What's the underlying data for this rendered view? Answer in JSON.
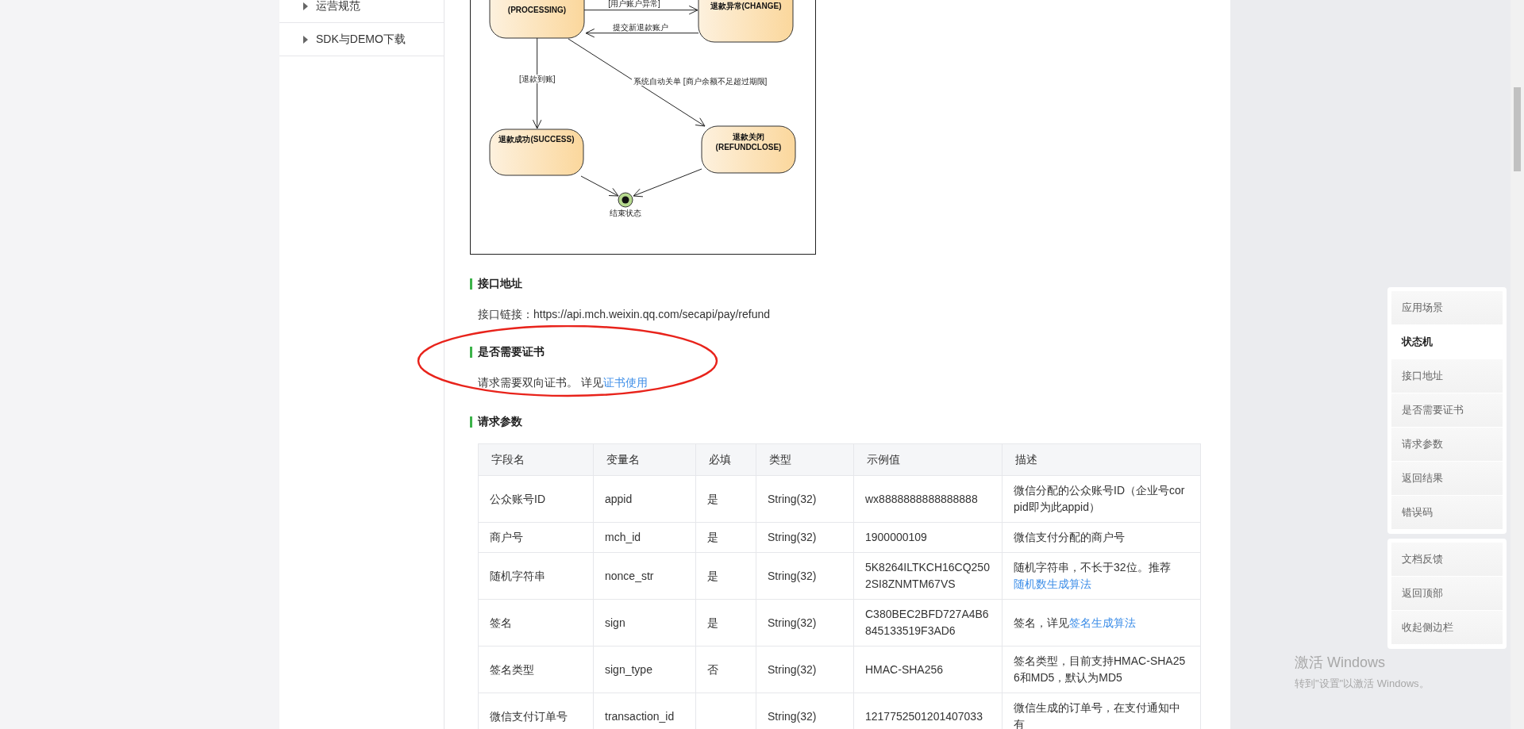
{
  "left_nav": {
    "items": [
      {
        "label": "运营规范"
      },
      {
        "label": "SDK与DEMO下载"
      }
    ]
  },
  "diagram": {
    "states": [
      {
        "lines": [
          "(PROCESSING)"
        ]
      },
      {
        "lines": [
          "退款异常(CHANGE)"
        ]
      },
      {
        "lines": [
          "退款成功(SUCCESS)"
        ]
      },
      {
        "lines": [
          "退款关闭",
          "(REFUNDCLOSE)"
        ]
      }
    ],
    "transitions": [
      {
        "label": "[用户账户异常]"
      },
      {
        "label": "提交新退款账户"
      },
      {
        "label": "[退款到账]"
      },
      {
        "label": "系统自动关单 [商户余额不足超过期限]"
      }
    ],
    "end_label": "结束状态"
  },
  "sections": [
    {
      "title": "接口地址",
      "text": "接口链接：https://api.mch.weixin.qq.com/secapi/pay/refund"
    },
    {
      "title": "是否需要证书",
      "text": "请求需要双向证书。 详见",
      "link": "证书使用"
    },
    {
      "title": "请求参数"
    }
  ],
  "table": {
    "columns": [
      "字段名",
      "变量名",
      "必填",
      "类型",
      "示例值",
      "描述"
    ],
    "rows": [
      {
        "cells": [
          "公众账号ID",
          "appid",
          "是",
          "String(32)",
          "wx8888888888888888"
        ],
        "description": {
          "text": "微信分配的公众账号ID（企业号corpid即为此appid）"
        }
      },
      {
        "cells": [
          "商户号",
          "mch_id",
          "是",
          "String(32)",
          "1900000109"
        ],
        "description": {
          "text": "微信支付分配的商户号"
        }
      },
      {
        "cells": [
          "随机字符串",
          "nonce_str",
          "是",
          "String(32)",
          "5K8264ILTKCH16CQ2502SI8ZNMTM67VS"
        ],
        "description": {
          "text": "随机字符串，不长于32位。推荐",
          "link": "随机数生成算法"
        }
      },
      {
        "cells": [
          "签名",
          "sign",
          "是",
          "String(32)",
          "C380BEC2BFD727A4B6845133519F3AD6"
        ],
        "description": {
          "text": "签名，详见",
          "link": "签名生成算法"
        }
      },
      {
        "cells": [
          "签名类型",
          "sign_type",
          "否",
          "String(32)",
          "HMAC-SHA256"
        ],
        "description": {
          "text": "签名类型，目前支持HMAC-SHA256和MD5，默认为MD5"
        }
      },
      {
        "cells": [
          "微信支付订单号",
          "transaction_id",
          "",
          "String(32)",
          "1217752501201407033"
        ],
        "description": {
          "text": "微信生成的订单号，在支付通知中有"
        }
      }
    ]
  },
  "right_panel": {
    "groups": [
      {
        "items": [
          {
            "label": "应用场景",
            "selected": false
          },
          {
            "label": "状态机",
            "selected": true
          },
          {
            "label": "接口地址",
            "selected": false
          },
          {
            "label": "是否需要证书",
            "selected": false
          },
          {
            "label": "请求参数",
            "selected": false
          },
          {
            "label": "返回结果",
            "selected": false
          },
          {
            "label": "错误码",
            "selected": false
          }
        ]
      },
      {
        "items": [
          {
            "label": "文档反馈",
            "selected": false
          },
          {
            "label": "返回顶部",
            "selected": false
          },
          {
            "label": "收起侧边栏",
            "selected": false
          }
        ]
      }
    ]
  },
  "os_watermark": {
    "title": "激活 Windows",
    "text": "转到\"设置\"以激活 Windows。"
  }
}
